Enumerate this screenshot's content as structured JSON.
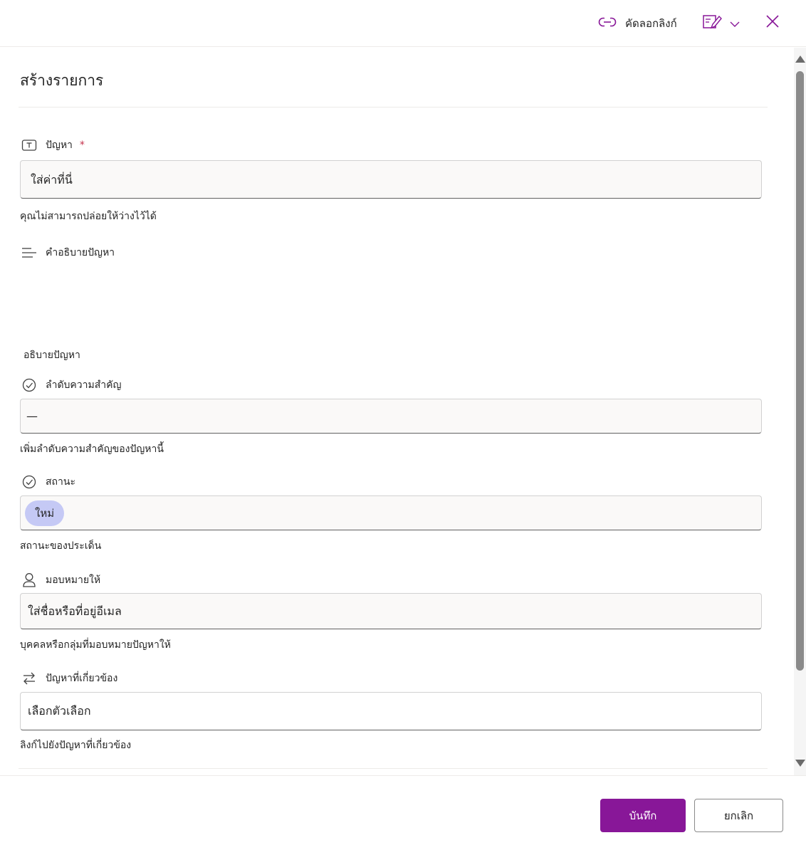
{
  "header": {
    "copy_link_label": "คัดลอกลิงก์",
    "icons": {
      "copy_link": "link-icon",
      "edit_form": "edit-form-icon",
      "dropdown": "chevron-down-icon",
      "close": "close-icon"
    }
  },
  "form": {
    "title": "สร้างรายการ",
    "fields": {
      "issue": {
        "label": "ปัญหา",
        "required_mark": "*",
        "placeholder": "ใส่ค่าที่นี่",
        "helper": "คุณไม่สามารถปล่อยให้ว่างไว้ได้"
      },
      "description": {
        "label": "คำอธิบายปัญหา",
        "helper": "อธิบายปัญหา"
      },
      "priority": {
        "label": "ลำดับความสำคัญ",
        "value": "—",
        "helper": "เพิ่มลำดับความสำคัญของปัญหานี้"
      },
      "status": {
        "label": "สถานะ",
        "value": "ใหม่",
        "helper": "สถานะของประเด็น"
      },
      "assigned_to": {
        "label": "มอบหมายให้",
        "placeholder": "ใส่ชื่อหรือที่อยู่อีเมล",
        "helper": "บุคคลหรือกลุ่มที่มอบหมายปัญหาให้"
      },
      "related_issues": {
        "label": "ปัญหาที่เกี่ยวข้อง",
        "placeholder": "เลือกตัวเลือก",
        "helper": "ลิงก์ไปยังปัญหาที่เกี่ยวข้อง"
      }
    }
  },
  "footer": {
    "save_label": "บันทึก",
    "cancel_label": "ยกเลิก"
  },
  "colors": {
    "accent": "#881798",
    "status_pill": "#c5c9f5",
    "required": "#c4314b",
    "field_bg": "#faf9f8"
  }
}
